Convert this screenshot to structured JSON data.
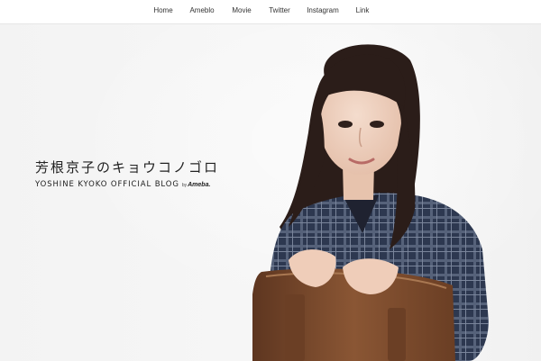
{
  "nav": {
    "items": [
      {
        "label": "Home"
      },
      {
        "label": "Ameblo"
      },
      {
        "label": "Movie"
      },
      {
        "label": "Twitter"
      },
      {
        "label": "Instagram"
      },
      {
        "label": "Link"
      }
    ]
  },
  "hero": {
    "title_jp": "芳根京子のキョウコノゴロ",
    "title_en": "YOSHINE KYOKO OFFICIAL BLOG",
    "by_label": "by",
    "ameba_logo": "Ameba."
  },
  "colors": {
    "background": "#f3f3f3",
    "nav_text": "#333333",
    "title_text": "#222222",
    "chair_wood": "#7a4a2c",
    "plaid_dark": "#2a3348",
    "hair": "#2b1d19"
  }
}
